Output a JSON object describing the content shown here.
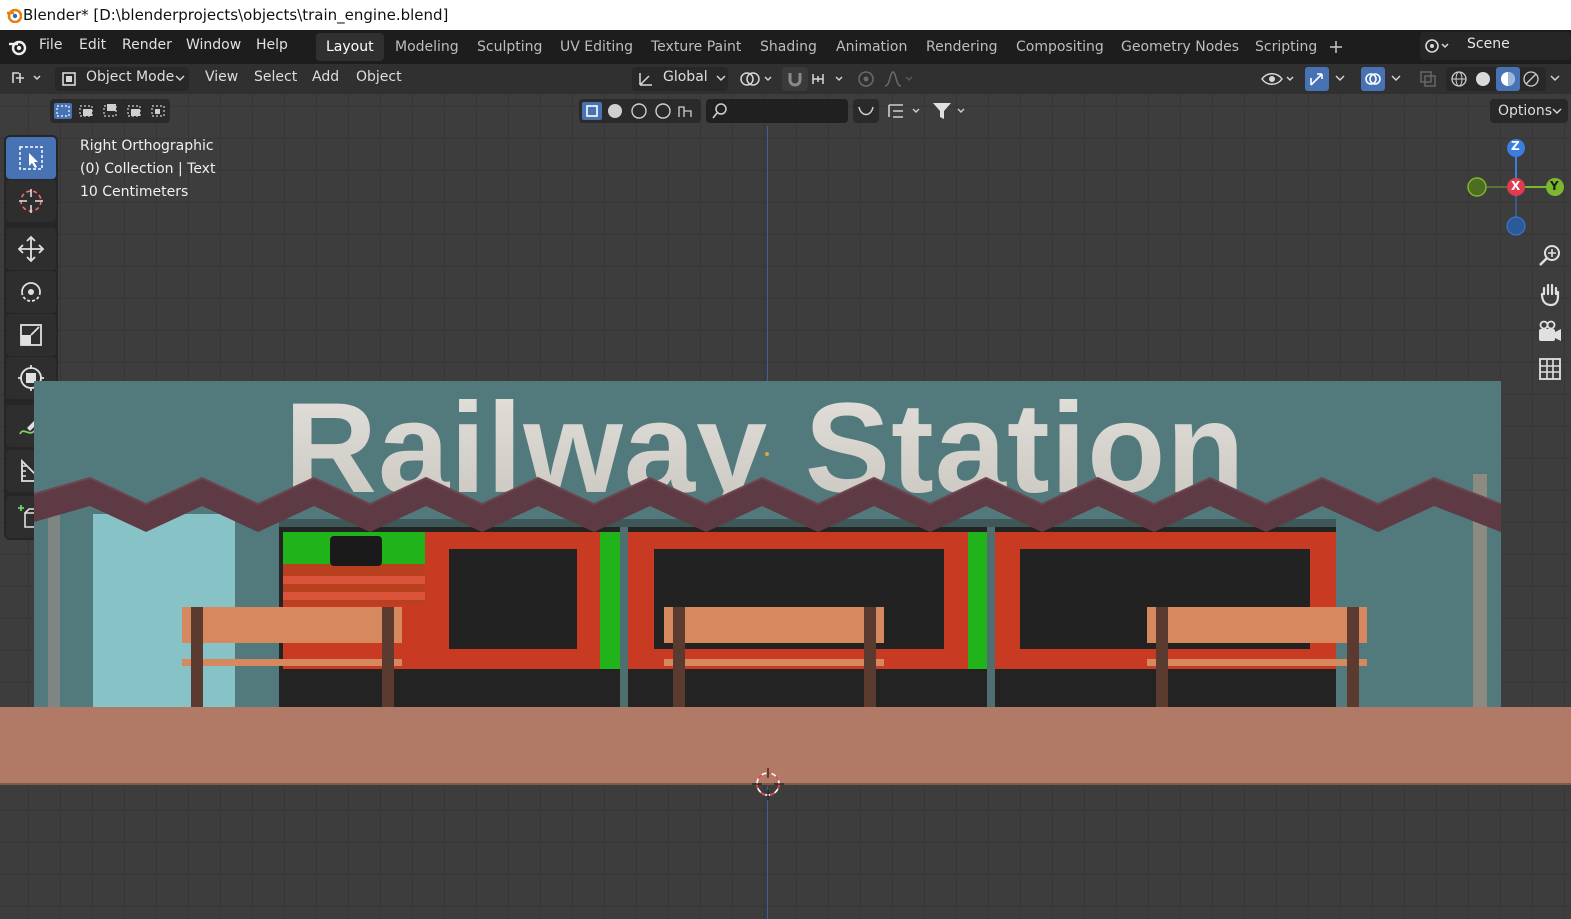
{
  "window": {
    "title": "Blender* [D:\\blenderprojects\\objects\\train_engine.blend]"
  },
  "menu": [
    "File",
    "Edit",
    "Render",
    "Window",
    "Help"
  ],
  "workspaces": [
    "Layout",
    "Modeling",
    "Sculpting",
    "UV Editing",
    "Texture Paint",
    "Shading",
    "Animation",
    "Rendering",
    "Compositing",
    "Geometry Nodes",
    "Scripting"
  ],
  "active_workspace": "Layout",
  "scene": {
    "name": "Scene"
  },
  "header": {
    "mode": "Object Mode",
    "view": "View",
    "select": "Select",
    "add": "Add",
    "object": "Object",
    "orientation": "Global"
  },
  "options_label": "Options",
  "viewport": {
    "view_name": "Right Orthographic",
    "collection": "(0) Collection | Text",
    "scale": "10 Centimeters",
    "scene_title": "Railway Station"
  },
  "gizmo": {
    "z": "Z",
    "x": "X",
    "y": "Y"
  },
  "colors": {
    "accent": "#4772b3",
    "axis_x": "#e13b4f",
    "axis_y": "#7ab82c",
    "axis_z": "#3a7ee0",
    "wall": "#527a7c",
    "platform": "#b07a66",
    "train_red": "#c93a22",
    "train_green": "#20b31a"
  },
  "icons": [
    "blender-logo-icon",
    "select-box-icon",
    "cursor-icon",
    "move-icon",
    "rotate-icon",
    "scale-icon",
    "transform-icon",
    "annotate-icon",
    "measure-icon",
    "add-cube-icon",
    "zoom-icon",
    "hand-icon",
    "camera-icon",
    "grid-icon",
    "filter-icon",
    "search-icon",
    "visibility-icon",
    "overlay-icon",
    "xray-icon",
    "shading-wire-icon",
    "shading-solid-icon",
    "shading-material-icon",
    "shading-render-icon"
  ]
}
